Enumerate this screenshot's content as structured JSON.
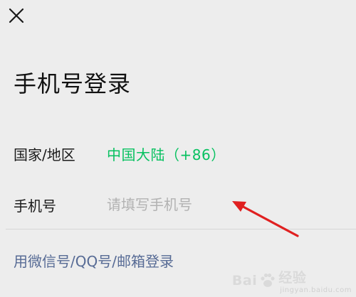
{
  "header": {
    "close_icon": "close-icon"
  },
  "page": {
    "title": "手机号登录"
  },
  "form": {
    "region": {
      "label": "国家/地区",
      "value": "中国大陆（+86）"
    },
    "phone": {
      "label": "手机号",
      "value": "",
      "placeholder": "请填写手机号"
    }
  },
  "links": {
    "alt_login": "用微信号/QQ号/邮箱登录"
  },
  "annotation": {
    "arrow_icon": "red-arrow-icon"
  },
  "watermark": {
    "brand": "Bai",
    "brand_suffix": "经验",
    "sub": "jingyan.baidu.com"
  },
  "colors": {
    "background": "#ededed",
    "accent_green": "#07c160",
    "link_blue": "#576b95",
    "placeholder_gray": "#b2b2b2",
    "annotation_red": "#e02020"
  }
}
